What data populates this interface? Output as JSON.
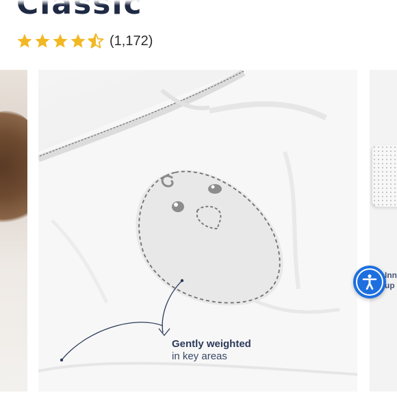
{
  "product": {
    "title": "Classic"
  },
  "rating": {
    "value": 4.5,
    "max": 5,
    "count_label": "(1,172)",
    "star_color": "#f2b824"
  },
  "carousel": {
    "callout": {
      "title": "Gently weighted",
      "subtitle": "in key areas"
    },
    "next_slide_text": {
      "line1": "Inn",
      "line2": "up"
    }
  },
  "accessibility": {
    "icon": "accessibility-icon",
    "color": "#1d6fe0"
  }
}
